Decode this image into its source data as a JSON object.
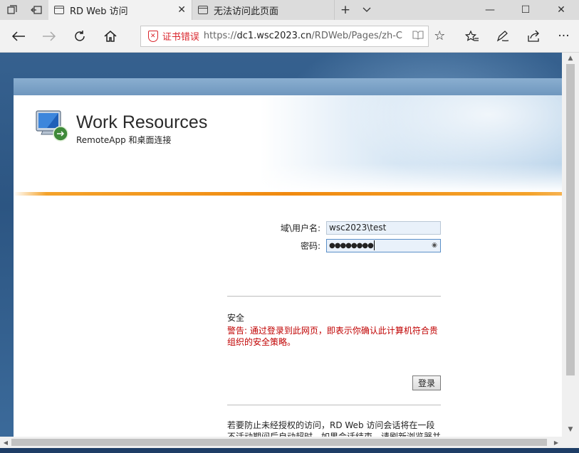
{
  "tabs": [
    {
      "title": "RD Web 访问",
      "active": true
    },
    {
      "title": "无法访问此页面",
      "active": false
    }
  ],
  "address_bar": {
    "cert_error": "证书错误",
    "url_scheme": "https://",
    "url_host": "dc1.wsc2023.cn",
    "url_path": "/RDWeb/Pages/zh-C"
  },
  "icons": {
    "tab_manager": "tab-manager-icon",
    "set_aside": "set-aside-tabs-icon",
    "back": "back-arrow-icon",
    "forward": "forward-arrow-icon",
    "refresh": "refresh-icon",
    "home": "home-icon",
    "reading_view": "reading-view-icon",
    "favorite": "star-icon",
    "favorites_hub": "favorites-list-icon",
    "notes": "pen-icon",
    "share": "share-icon",
    "more": "more-icon"
  },
  "page": {
    "title": "Work Resources",
    "subtitle": "RemoteApp 和桌面连接",
    "username_label": "域\\用户名:",
    "username_value": "wsc2023\\test",
    "password_label": "密码:",
    "password_value": "●●●●●●●●",
    "security_heading": "安全",
    "security_warning": "警告: 通过登录到此网页，即表示你确认此计算机符合贵组织的安全策略。",
    "login_button": "登录",
    "timeout_notice": "若要防止未经授权的访问，RD Web 访问会话将在一段不活动期间后自动超时。如果会话结束，请刷新浏览器并再次登录。"
  },
  "colors": {
    "warning_text": "#c00000",
    "cert_error": "#d9252c",
    "accent_orange": "#f08a10"
  }
}
